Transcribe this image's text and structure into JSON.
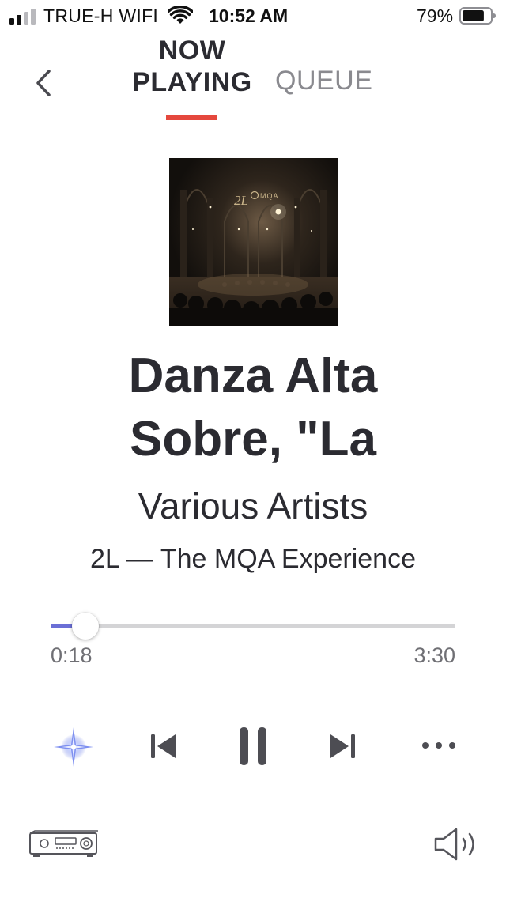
{
  "status_bar": {
    "carrier": "TRUE-H WIFI",
    "time": "10:52 AM",
    "battery_percent": "79%",
    "battery_level": 0.79,
    "signal_bars_filled": 2
  },
  "header": {
    "tab_now_line1": "NOW",
    "tab_now_line2": "PLAYING",
    "tab_queue": "QUEUE",
    "active_tab": "NOW PLAYING"
  },
  "track": {
    "title_line1": "Danza Alta",
    "title_line2": "Sobre, \"La",
    "artist": "Various Artists",
    "album": "2L — The MQA Experience",
    "cover_text_label": "2L",
    "cover_text_badge": "MQA"
  },
  "progress": {
    "elapsed": "0:18",
    "total": "3:30",
    "fraction": 0.0857
  },
  "controls": {
    "icons": [
      "sparkle-icon",
      "previous-track-icon",
      "pause-icon",
      "next-track-icon",
      "more-icon"
    ]
  },
  "bottom": {
    "icons": [
      "receiver-icon",
      "volume-icon"
    ]
  },
  "colors": {
    "accent_red": "#e5483d",
    "progress_fill": "#6b6fd6",
    "text_primary": "#2b2b31",
    "text_muted": "#8a8a8f"
  }
}
